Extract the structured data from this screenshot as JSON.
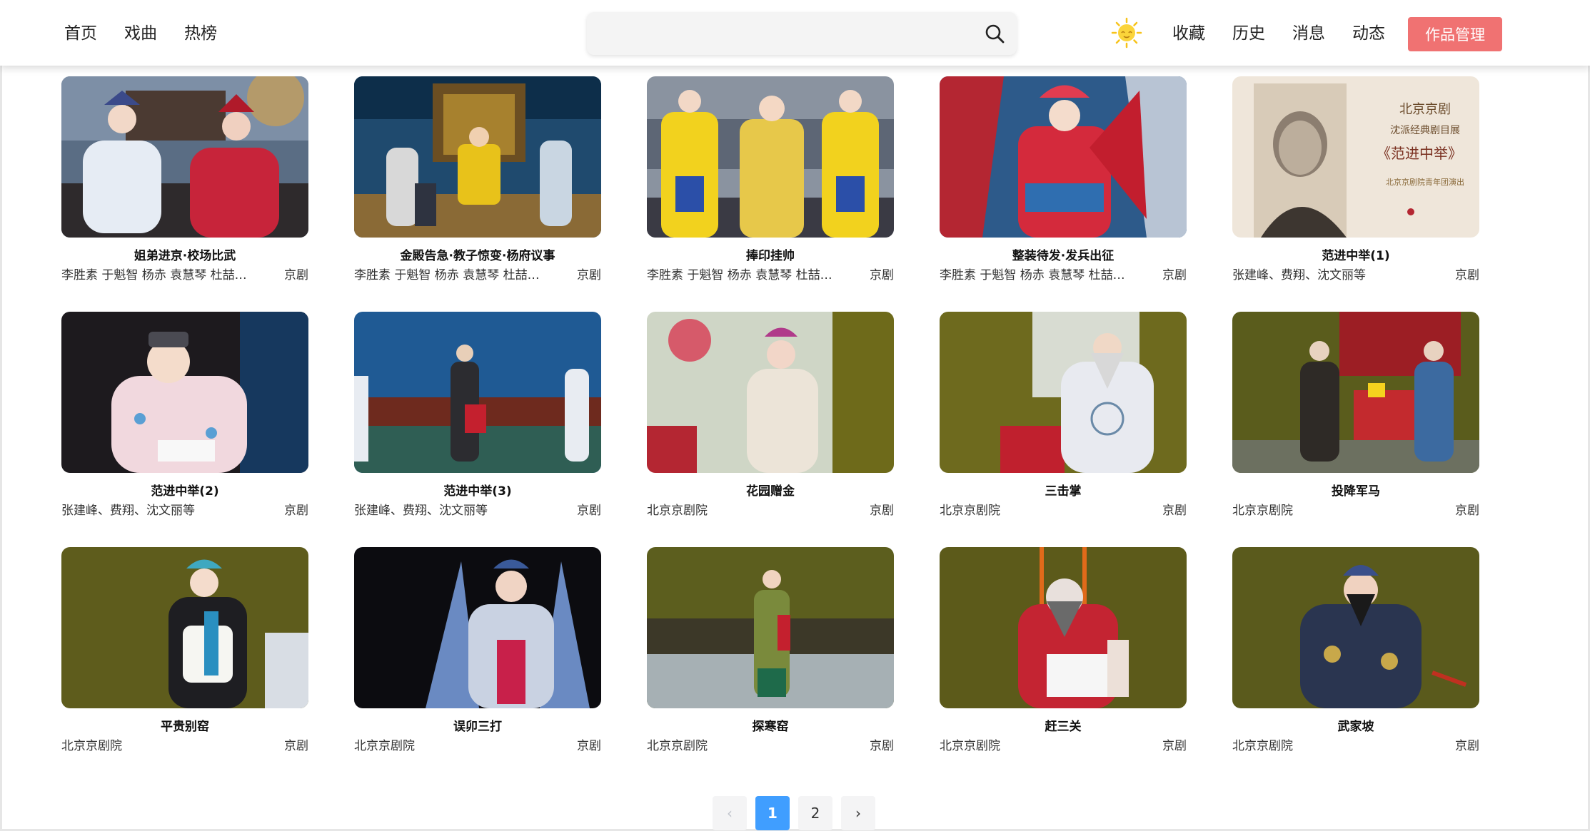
{
  "header": {
    "nav_left": [
      "首页",
      "戏曲",
      "热榜"
    ],
    "search": {
      "value": "",
      "placeholder": "",
      "icon": "search-icon"
    },
    "theme_icon": "sun-icon",
    "nav_right": [
      "收藏",
      "历史",
      "消息",
      "动态"
    ],
    "manage_button": "作品管理",
    "colors": {
      "accent": "#f07272",
      "active_page": "#409eff"
    }
  },
  "videos": [
    {
      "title": "姐弟进京·校场比武",
      "artists": "李胜素 于魁智 杨赤 袁慧琴 杜喆…",
      "genre": "京剧"
    },
    {
      "title": "金殿告急·教子惊变·杨府议事",
      "artists": "李胜素 于魁智 杨赤 袁慧琴 杜喆…",
      "genre": "京剧"
    },
    {
      "title": "捧印挂帅",
      "artists": "李胜素 于魁智 杨赤 袁慧琴 杜喆…",
      "genre": "京剧"
    },
    {
      "title": "整装待发·发兵出征",
      "artists": "李胜素 于魁智 杨赤 袁慧琴 杜喆…",
      "genre": "京剧"
    },
    {
      "title": "范进中举(1)",
      "artists": "张建峰、费翔、沈文丽等",
      "genre": "京剧"
    },
    {
      "title": "范进中举(2)",
      "artists": "张建峰、费翔、沈文丽等",
      "genre": "京剧"
    },
    {
      "title": "范进中举(3)",
      "artists": "张建峰、费翔、沈文丽等",
      "genre": "京剧"
    },
    {
      "title": "花园赠金",
      "artists": "北京京剧院",
      "genre": "京剧"
    },
    {
      "title": "三击掌",
      "artists": "北京京剧院",
      "genre": "京剧"
    },
    {
      "title": "投降军马",
      "artists": "北京京剧院",
      "genre": "京剧"
    },
    {
      "title": "平贵别窑",
      "artists": "北京京剧院",
      "genre": "京剧"
    },
    {
      "title": "误卯三打",
      "artists": "北京京剧院",
      "genre": "京剧"
    },
    {
      "title": "探寒窑",
      "artists": "北京京剧院",
      "genre": "京剧"
    },
    {
      "title": "赶三关",
      "artists": "北京京剧院",
      "genre": "京剧"
    },
    {
      "title": "武家坡",
      "artists": "北京京剧院",
      "genre": "京剧"
    }
  ],
  "poster_text": {
    "line1": "北京京剧",
    "line2": "沈派经典剧目展",
    "line3": "《范进中举》",
    "line4": "北京京剧院青年团演出"
  },
  "pagination": {
    "prev": "‹",
    "pages": [
      "1",
      "2"
    ],
    "current": "1",
    "next": "›"
  }
}
